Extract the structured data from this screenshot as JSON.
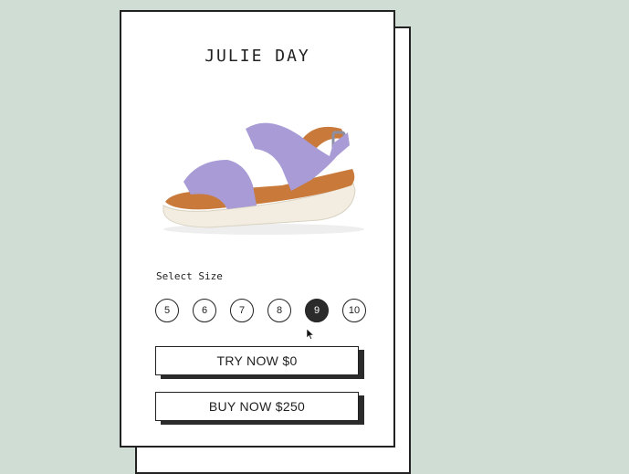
{
  "product": {
    "brand": "JULIE DAY",
    "image_alt": "Lavender strap sandal with tan footbed and white sole"
  },
  "size_selector": {
    "label": "Select Size",
    "sizes": [
      "5",
      "6",
      "7",
      "8",
      "9",
      "10"
    ],
    "selected": "9"
  },
  "actions": {
    "try_now": "TRY NOW $0",
    "buy_now": "BUY NOW $250"
  },
  "colors": {
    "background": "#cfddd4",
    "strap": "#a89bd6",
    "footbed": "#c97a3b",
    "sole": "#f2ede0",
    "ink": "#222222"
  }
}
